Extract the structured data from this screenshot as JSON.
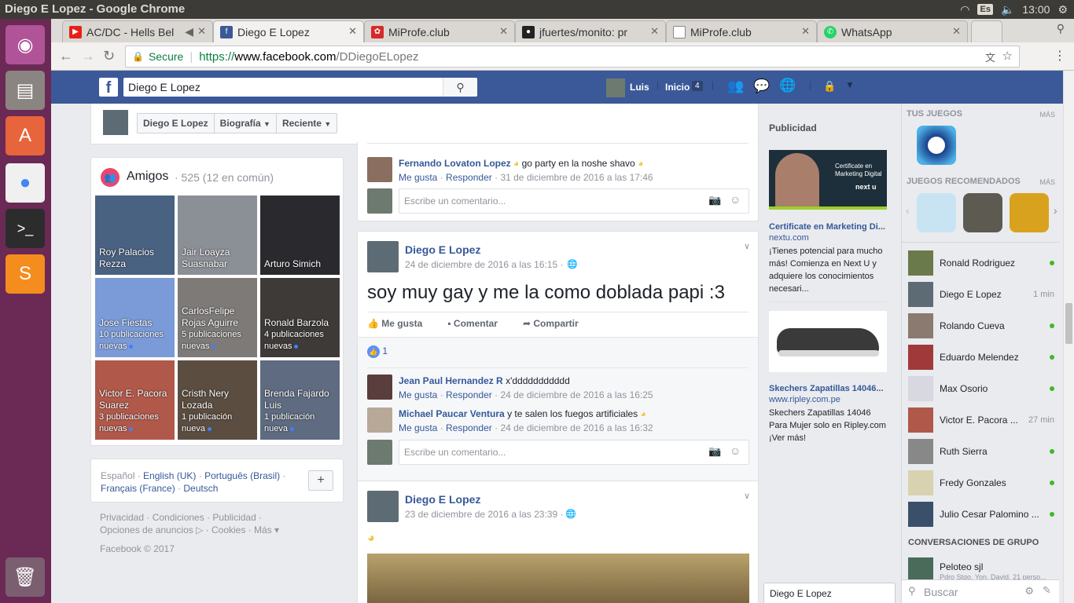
{
  "os": {
    "window_title": "Diego E Lopez - Google Chrome",
    "lang": "Es",
    "clock": "13:00"
  },
  "browser": {
    "tabs": [
      {
        "label": "AC/DC - Hells Bel",
        "icon": "youtube-icon",
        "color": "#e62117"
      },
      {
        "label": "Diego E Lopez",
        "icon": "facebook-icon",
        "color": "#3b5998"
      },
      {
        "label": "MiProfe.club",
        "icon": "miprofe-icon",
        "color": "#d62a2a"
      },
      {
        "label": "jfuertes/monito: pr",
        "icon": "github-icon",
        "color": "#222"
      },
      {
        "label": "MiProfe.club",
        "icon": "page-icon",
        "color": "#888"
      },
      {
        "label": "WhatsApp",
        "icon": "whatsapp-icon",
        "color": "#25d366"
      }
    ],
    "secure_label": "Secure",
    "url_scheme": "https://",
    "url_host": "www.facebook.com",
    "url_path": "/DDiegoELopez"
  },
  "fb": {
    "search_value": "Diego E Lopez",
    "user_name": "Luis",
    "home_label": "Inicio",
    "home_count": "4"
  },
  "profile_nav": {
    "name": "Diego E Lopez",
    "timeline": "Biografía",
    "recent": "Reciente"
  },
  "friends": {
    "title": "Amigos",
    "count": "· 525 (12 en común)",
    "items": [
      {
        "name": "Roy Palacios Rezza",
        "sub": "",
        "color": "#4a6282"
      },
      {
        "name": "Jair Loayza Suasnabar",
        "sub": "",
        "color": "#8b8f96"
      },
      {
        "name": "Arturo Simich",
        "sub": "",
        "color": "#2a2a2e"
      },
      {
        "name": "Jose Fiestas",
        "sub": "10 publicaciones nuevas",
        "color": "#7a9ad8"
      },
      {
        "name": "CarlosFelipe Rojas Aguirre",
        "sub": "5 publicaciones nuevas",
        "color": "#7d7a78"
      },
      {
        "name": "Ronald Barzola",
        "sub": "4 publicaciones nuevas",
        "color": "#3e3a38"
      },
      {
        "name": "Victor E. Pacora Suarez",
        "sub": "3 publicaciones nuevas",
        "color": "#b0584a"
      },
      {
        "name": "Cristh Nery Lozada",
        "sub": "1 publicación nueva",
        "color": "#5b4d40"
      },
      {
        "name": "Brenda Fajardo Luis",
        "sub": "1 publicación nueva",
        "color": "#5e6b80"
      }
    ]
  },
  "languages": {
    "line1a": "Español",
    "line1b": "English (UK)",
    "line1c": "Português (Brasil)",
    "line2a": "Français (France)",
    "line2b": "Deutsch",
    "add": "+"
  },
  "footer": {
    "links1": "Privacidad · Condiciones · Publicidad ·",
    "links2": "Opciones de anuncios ▷ · Cookies · Más ▾",
    "copyright": "Facebook © 2017"
  },
  "posts": {
    "prev_comment": {
      "author": "Fernando Lovaton Lopez",
      "text": "go party en la noshe shavo",
      "like": "Me gusta",
      "reply": "Responder",
      "date": "31 de diciembre de 2016 a las 17:46"
    },
    "comment_placeholder": "Escribe un comentario...",
    "post1": {
      "author": "Diego E Lopez",
      "date": "24 de diciembre de 2016 a las 16:15 ·",
      "text": "soy muy gay y me la como doblada papi :3",
      "like": "Me gusta",
      "comment": "Comentar",
      "share": "Compartir",
      "likes_count": "1",
      "comments": [
        {
          "author": "Jean Paul Hernandez R",
          "text": "x'ddddddddddd",
          "like": "Me gusta",
          "reply": "Responder",
          "date": "24 de diciembre de 2016 a las 16:25"
        },
        {
          "author": "Michael Paucar Ventura",
          "text": "y te salen los fuegos artificiales",
          "like": "Me gusta",
          "reply": "Responder",
          "date": "24 de diciembre de 2016 a las 16:32"
        }
      ]
    },
    "post2": {
      "author": "Diego E Lopez",
      "date": "23 de diciembre de 2016 a las 23:39 ·"
    }
  },
  "ads": {
    "title": "Publicidad",
    "ad1": {
      "headline": "Certificate en Marketing Di...",
      "domain": "nextu.com",
      "body": "¡Tienes potencial para mucho más! Comienza en Next U y adquiere los conocimientos necesari...",
      "img_text1": "Certificate en",
      "img_text2": "Marketing Digital",
      "img_brand": "next u"
    },
    "ad2": {
      "headline": "Skechers Zapatillas 14046...",
      "domain": "www.ripley.com.pe",
      "body": "Skechers Zapatillas 14046 Para Mujer solo en Ripley.com ¡Ver más!"
    },
    "chat_tab": "Diego E Lopez"
  },
  "sidebar": {
    "games_title": "TUS JUEGOS",
    "more1": "MÁS",
    "rec_title": "JUEGOS RECOMENDADOS",
    "more2": "MÁS",
    "contacts": [
      {
        "name": "Ronald Rodriguez",
        "status": "",
        "online": true
      },
      {
        "name": "Diego E Lopez",
        "status": "1 min",
        "online": false
      },
      {
        "name": "Rolando Cueva",
        "status": "",
        "online": true
      },
      {
        "name": "Eduardo Melendez",
        "status": "",
        "online": true
      },
      {
        "name": "Max Osorio",
        "status": "",
        "online": true
      },
      {
        "name": "Victor E. Pacora ...",
        "status": "27 min",
        "online": false
      },
      {
        "name": "Ruth Sierra",
        "status": "",
        "online": true
      },
      {
        "name": "Fredy Gonzales",
        "status": "",
        "online": true
      },
      {
        "name": "Julio Cesar Palomino ...",
        "status": "",
        "online": true
      }
    ],
    "group_title": "CONVERSACIONES DE GRUPO",
    "group_name": "Peloteo sjl",
    "group_members": "Pdro Stgo, Yon, David, 21 perso...",
    "search_placeholder": "Buscar"
  }
}
